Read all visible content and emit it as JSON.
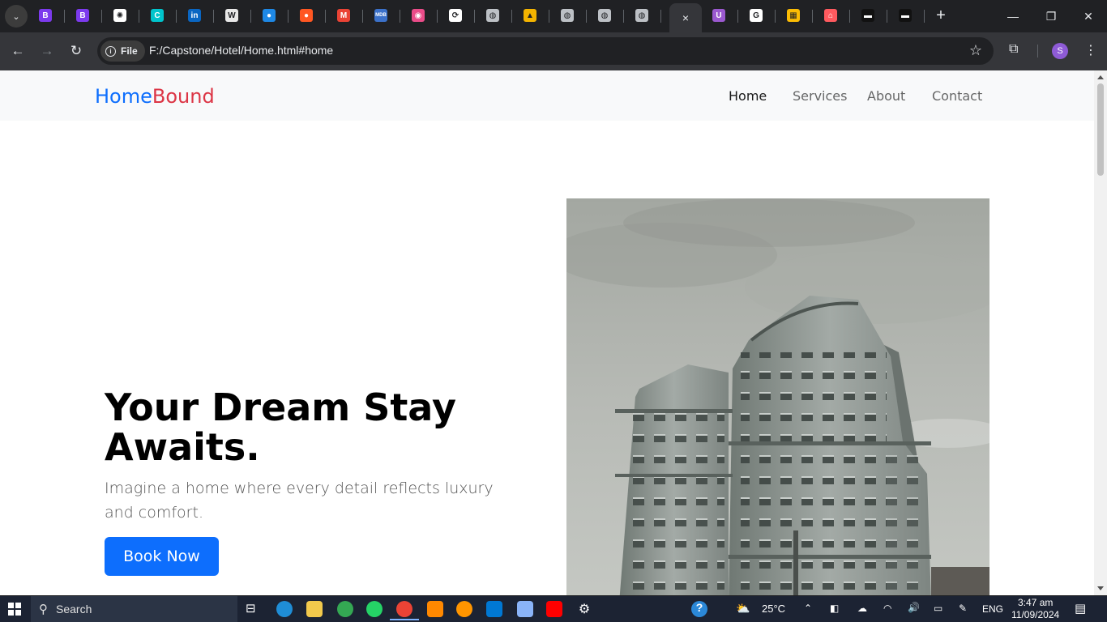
{
  "browser": {
    "url": "F:/Capstone/Hotel/Home.html#home",
    "security_chip": "File",
    "profile_initial": "S",
    "active_tab_close": "×"
  },
  "tabs": [
    {
      "icon": "bootstrap-icon",
      "glyph": "B",
      "color": "#7c3aed"
    },
    {
      "icon": "bootstrap-icon",
      "glyph": "B",
      "color": "#7c3aed"
    },
    {
      "icon": "chatgpt-icon",
      "glyph": "✺",
      "color": "#ffffff"
    },
    {
      "icon": "canva-icon",
      "glyph": "C",
      "color": "#00c4cc"
    },
    {
      "icon": "linkedin-icon",
      "glyph": "in",
      "color": "#0a66c2"
    },
    {
      "icon": "wikipedia-icon",
      "glyph": "W",
      "color": "#e8e8e8"
    },
    {
      "icon": "globe-blue-icon",
      "glyph": "●",
      "color": "#1e88e5"
    },
    {
      "icon": "firebase-icon",
      "glyph": "●",
      "color": "#ff5722"
    },
    {
      "icon": "gmail-icon",
      "glyph": "M",
      "color": "#ea4335"
    },
    {
      "icon": "mdb-icon",
      "glyph": "MDB",
      "color": "#3b71ca"
    },
    {
      "icon": "dribbble-icon",
      "glyph": "◉",
      "color": "#ea4c89"
    },
    {
      "icon": "link-icon",
      "glyph": "⟳",
      "color": "#ffffff"
    },
    {
      "icon": "globe-icon",
      "glyph": "◍",
      "color": "#bdc1c6"
    },
    {
      "icon": "graduation-cap-icon",
      "glyph": "▲",
      "color": "#f4b400"
    },
    {
      "icon": "globe-icon",
      "glyph": "◍",
      "color": "#bdc1c6"
    },
    {
      "icon": "globe-icon",
      "glyph": "◍",
      "color": "#bdc1c6"
    },
    {
      "icon": "globe-icon",
      "glyph": "◍",
      "color": "#bdc1c6"
    }
  ],
  "tabs_right": [
    {
      "icon": "upwork-icon",
      "glyph": "U",
      "color": "#9b59d0"
    },
    {
      "icon": "google-icon",
      "glyph": "G",
      "color": "#ffffff"
    },
    {
      "icon": "photos-icon",
      "glyph": "▦",
      "color": "#fbbc04"
    },
    {
      "icon": "airbnb-icon",
      "glyph": "⌂",
      "color": "#ff5a5f"
    },
    {
      "icon": "unsplash-icon",
      "glyph": "▬",
      "color": "#111111"
    },
    {
      "icon": "unsplash-icon",
      "glyph": "▬",
      "color": "#111111"
    }
  ],
  "site": {
    "brand_part1": "Home",
    "brand_part2": "Bound",
    "nav": [
      "Home",
      "Services",
      "About",
      "Contact"
    ],
    "hero_title": "Your Dream Stay Awaits.",
    "hero_lead": "Imagine a home where every detail reflects luxury and comfort.",
    "cta": "Book Now"
  },
  "colors": {
    "primary": "#0d6efd",
    "brand_accent": "#dc3545"
  },
  "taskbar": {
    "search_label": "Search",
    "weather": "25°C",
    "language": "ENG",
    "time": "3:47 am",
    "date": "11/09/2024"
  }
}
